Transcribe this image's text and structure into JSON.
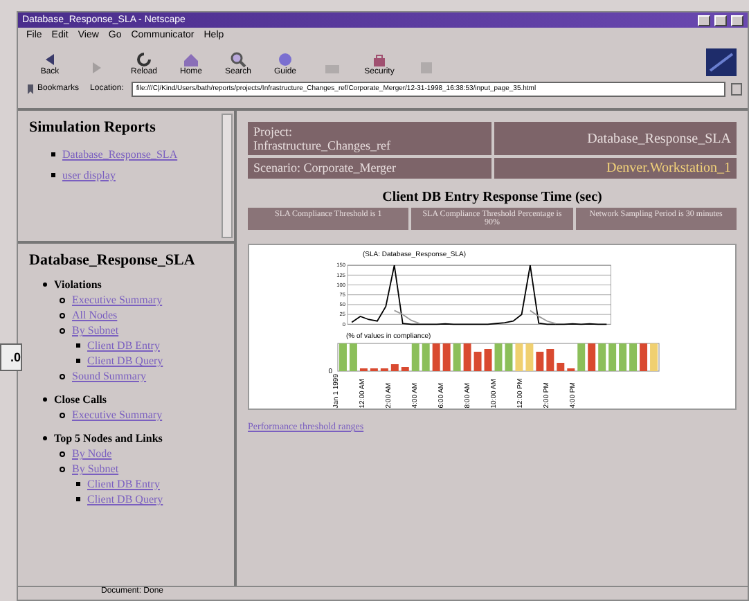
{
  "behind_window": {
    "text": ".0"
  },
  "window": {
    "title": "Database_Response_SLA - Netscape"
  },
  "menu": [
    "File",
    "Edit",
    "View",
    "Go",
    "Communicator",
    "Help"
  ],
  "toolbar": [
    {
      "kind": "back",
      "label": "Back",
      "disabled": false
    },
    {
      "kind": "forward",
      "disabled": true
    },
    {
      "kind": "reload",
      "label": "Reload",
      "disabled": false
    },
    {
      "kind": "home",
      "label": "Home",
      "disabled": false
    },
    {
      "kind": "search",
      "label": "Search",
      "disabled": false
    },
    {
      "kind": "guide",
      "label": "Guide",
      "disabled": false
    },
    {
      "kind": "print",
      "disabled": true
    },
    {
      "kind": "security",
      "label": "Security",
      "disabled": false
    },
    {
      "kind": "stop",
      "disabled": true
    }
  ],
  "location_bar": {
    "bookmarks": "Bookmarks",
    "label": "Location:",
    "url": "file:///C|/Kind/Users/bath/reports/projects/Infrastructure_Changes_ref/Corporate_Merger/12-31-1998_16:38:53/input_page_35.html"
  },
  "sidebar": {
    "reports": {
      "title": "Simulation Reports",
      "links": [
        "Database_Response_SLA",
        "user display"
      ]
    },
    "outline": {
      "title": "Database_Response_SLA",
      "items": [
        {
          "label": "Violations",
          "children": [
            {
              "label": "Executive Summary"
            },
            {
              "label": "All Nodes"
            },
            {
              "label": "By Subnet",
              "children": [
                {
                  "label": "Client DB Entry"
                },
                {
                  "label": "Client DB Query"
                }
              ]
            },
            {
              "label": "Sound Summary"
            }
          ]
        },
        {
          "label": "Close Calls",
          "children": [
            {
              "label": "Executive Summary"
            }
          ]
        },
        {
          "label": "Top 5 Nodes and Links",
          "children": [
            {
              "label": "By Node"
            },
            {
              "label": "By Subnet",
              "children": [
                {
                  "label": "Client DB Entry"
                },
                {
                  "label": "Client DB Query"
                }
              ]
            }
          ]
        }
      ]
    }
  },
  "header": {
    "project": "Project:\nInfrastructure_Changes_ref",
    "sla": "Database_Response_SLA",
    "scenario": "Scenario: Corporate_Merger",
    "node": "Denver.Workstation_1"
  },
  "report": {
    "title": "Client DB Entry Response Time (sec)",
    "facts": [
      "SLA Compliance Threshold is 1",
      "SLA Compliance Threshold Percentage is 90%",
      "Network Sampling Period is 30 minutes"
    ],
    "chart_data": {
      "type": "line",
      "title": "(SLA: Database_Response_SLA)",
      "categories": [
        null,
        null,
        null,
        null,
        null,
        null,
        null,
        null,
        null,
        null,
        null,
        null,
        null,
        null,
        null,
        null,
        null,
        null,
        null,
        null,
        null,
        null,
        null,
        null,
        null,
        null,
        null,
        null,
        null,
        null,
        null
      ],
      "series": [
        {
          "color": "#000000",
          "values": [
            5,
            20,
            12,
            8,
            45,
            150,
            2,
            0,
            0,
            0,
            0,
            1,
            0,
            0,
            0,
            0,
            0,
            2,
            4,
            8,
            25,
            150,
            3,
            0,
            0,
            0,
            1,
            0,
            1,
            0,
            0
          ]
        },
        {
          "color": "#999999",
          "values": [
            null,
            null,
            null,
            null,
            null,
            35,
            25,
            10,
            2,
            null,
            null,
            null,
            null,
            null,
            null,
            null,
            null,
            null,
            null,
            null,
            null,
            35,
            20,
            8,
            2,
            null,
            null,
            null,
            null,
            null,
            null
          ]
        }
      ],
      "ylim": [
        0,
        150
      ],
      "yticks": [
        0,
        25,
        50,
        75,
        100,
        125,
        150
      ],
      "grid": true
    },
    "compliance": {
      "title": "(% of values in compliance)",
      "axis_label": "0"
    },
    "time_labels": [
      "Jan 1 1999",
      "12:00 AM",
      "2:00 AM",
      "4:00 AM",
      "6:00 AM",
      "8:00 AM",
      "10:00 AM",
      "12:00 PM",
      "2:00 PM",
      "4:00 PM"
    ],
    "link": "Performance threshold ranges"
  },
  "status_bar": {
    "text": "Document: Done"
  }
}
